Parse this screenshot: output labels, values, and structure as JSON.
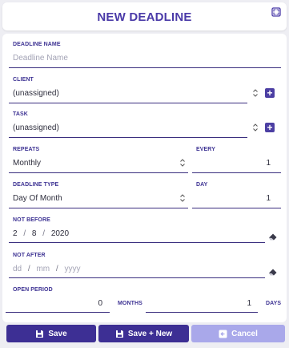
{
  "header": {
    "title": "NEW DEADLINE",
    "expand_icon": "expand-icon"
  },
  "fields": {
    "deadline_name": {
      "label": "DEADLINE NAME",
      "placeholder": "Deadline Name",
      "value": ""
    },
    "client": {
      "label": "CLIENT",
      "value": "(unassigned)"
    },
    "task": {
      "label": "TASK",
      "value": "(unassigned)"
    },
    "repeats": {
      "label": "REPEATS",
      "value": "Monthly"
    },
    "every": {
      "label": "EVERY",
      "value": "1"
    },
    "deadline_type": {
      "label": "DEADLINE TYPE",
      "value": "Day Of Month"
    },
    "day": {
      "label": "DAY",
      "value": "1"
    },
    "not_before": {
      "label": "NOT BEFORE",
      "month": "2",
      "day": "8",
      "year": "2020",
      "sep": "/"
    },
    "not_after": {
      "label": "NOT AFTER",
      "month_ph": "dd",
      "day_ph": "mm",
      "year_ph": "yyyy",
      "sep": "/"
    },
    "open_period": {
      "label": "OPEN PERIOD",
      "months_value": "0",
      "months_unit": "MONTHS",
      "days_value": "1",
      "days_unit": "DAYS"
    }
  },
  "buttons": {
    "save": "Save",
    "save_new": "Save + New",
    "cancel": "Cancel"
  },
  "colors": {
    "accent": "#3d2f94",
    "title": "#4a3aa8",
    "label": "#3f3494",
    "cancel_bg": "#a9a8ea",
    "background": "#eeeef3"
  }
}
